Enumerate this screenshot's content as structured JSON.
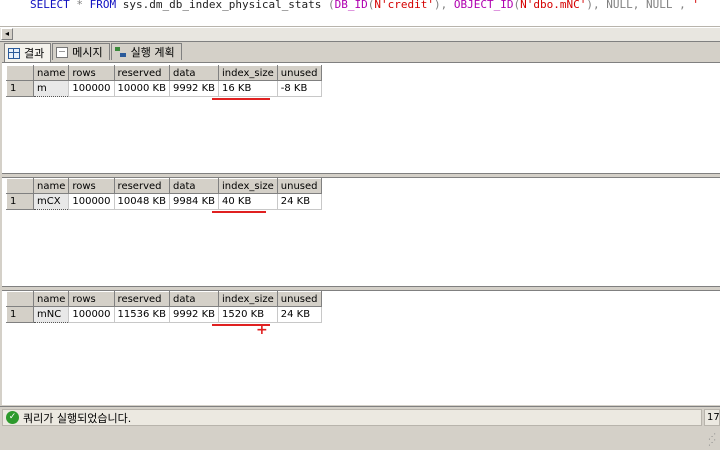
{
  "editor": {
    "query_parts": [
      {
        "text": "SELECT",
        "cls": "kw"
      },
      {
        "text": " * ",
        "cls": "gry"
      },
      {
        "text": "FROM",
        "cls": "kw"
      },
      {
        "text": " sys.dm_db_index_physical_stats ",
        "cls": ""
      },
      {
        "text": "(",
        "cls": "gry"
      },
      {
        "text": "DB_ID",
        "cls": "fn"
      },
      {
        "text": "(",
        "cls": "gry"
      },
      {
        "text": "N'credit'",
        "cls": "str"
      },
      {
        "text": "), ",
        "cls": "gry"
      },
      {
        "text": "OBJECT_ID",
        "cls": "fn"
      },
      {
        "text": "(",
        "cls": "gry"
      },
      {
        "text": "N'dbo.mNC'",
        "cls": "str"
      },
      {
        "text": "), NULL, NULL , ",
        "cls": "gry"
      },
      {
        "text": "'",
        "cls": "str"
      }
    ]
  },
  "tabs": [
    {
      "label": "결과",
      "icon": "grid-icon"
    },
    {
      "label": "메시지",
      "icon": "message-icon"
    },
    {
      "label": "실행 계획",
      "icon": "execution-plan-icon"
    }
  ],
  "result_columns": [
    "name",
    "rows",
    "reserved",
    "data",
    "index_size",
    "unused"
  ],
  "result_sets": [
    {
      "row_number": "1",
      "cells": [
        "m",
        "100000",
        "10000 KB",
        "9992 KB",
        "16 KB",
        "-8 KB"
      ]
    },
    {
      "row_number": "1",
      "cells": [
        "mCX",
        "100000",
        "10048 KB",
        "9984 KB",
        "40 KB",
        "24 KB"
      ]
    },
    {
      "row_number": "1",
      "cells": [
        "mNC",
        "100000",
        "11536 KB",
        "9992 KB",
        "1520 KB",
        "24 KB"
      ]
    }
  ],
  "status": {
    "message": "쿼리가 실행되었습니다.",
    "right_text": "17"
  },
  "colors": {
    "annotation_red": "#e02020",
    "status_check_green": "#2d9a2d"
  }
}
